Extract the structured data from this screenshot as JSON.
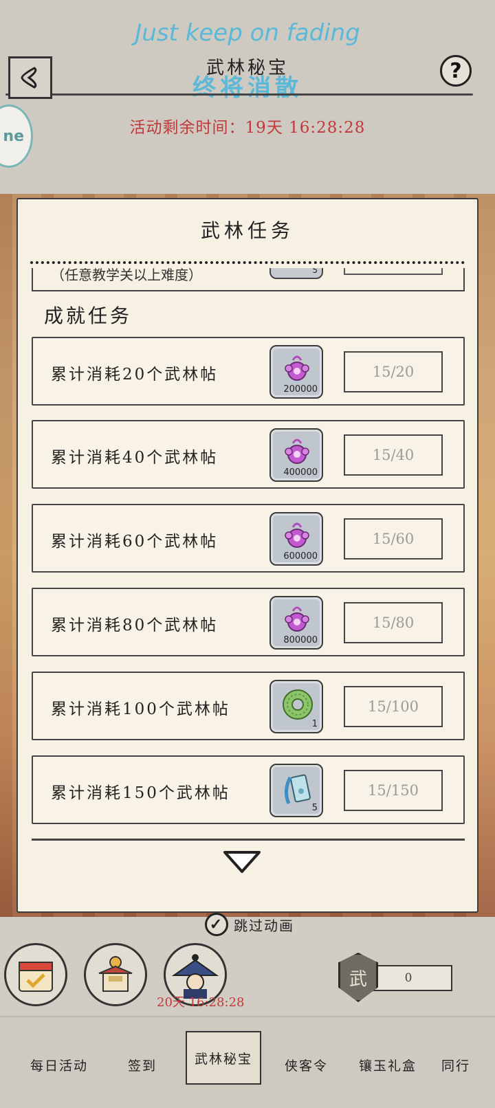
{
  "header": {
    "watermark_en": "Just keep on fading",
    "title": "武林秘宝",
    "watermark_cn": "终将消散",
    "help_label": "?",
    "side_badge": "ne",
    "timer": "活动剩余时间：19天 16:28:28"
  },
  "panel": {
    "title": "武林任务",
    "partial_row": {
      "text": "（任意教学关以上难度）",
      "qty": "5"
    },
    "section_label": "成就任务",
    "rows": [
      {
        "label": "累计消耗20个武林帖",
        "reward_icon": "purple-gem-icon",
        "qty": "200000",
        "progress": "15/20"
      },
      {
        "label": "累计消耗40个武林帖",
        "reward_icon": "purple-gem-icon",
        "qty": "400000",
        "progress": "15/40"
      },
      {
        "label": "累计消耗60个武林帖",
        "reward_icon": "purple-gem-icon",
        "qty": "600000",
        "progress": "15/60"
      },
      {
        "label": "累计消耗80个武林帖",
        "reward_icon": "purple-gem-icon",
        "qty": "800000",
        "progress": "15/80"
      },
      {
        "label": "累计消耗100个武林帖",
        "reward_icon": "jade-disc-icon",
        "qty": "1",
        "progress": "15/100"
      },
      {
        "label": "累计消耗150个武林帖",
        "reward_icon": "scroll-ticket-icon",
        "qty": "5",
        "progress": "15/150"
      }
    ]
  },
  "lower": {
    "skip_label": "跳过动画",
    "countdown": "20天 16:28:28",
    "coin_value": "0",
    "coin_emblem": "武"
  },
  "tabs": [
    {
      "label": "每日活动",
      "active": false
    },
    {
      "label": "签到",
      "active": false
    },
    {
      "label": "武林秘宝",
      "active": true
    },
    {
      "label": "侠客令",
      "active": false
    },
    {
      "label": "镶玉礼盒",
      "active": false
    },
    {
      "label": "同行",
      "active": false
    }
  ],
  "colors": {
    "timer_red": "#c0393b",
    "watermark_blue": "#5bb8d8",
    "paper": "#f6f1e3"
  }
}
